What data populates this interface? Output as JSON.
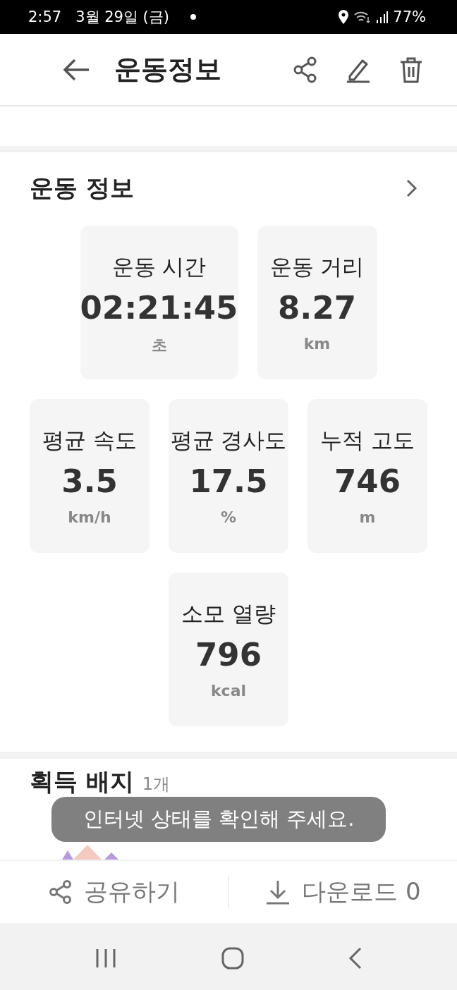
{
  "status_bar": {
    "time": "2:57",
    "date": "3월 29일 (금)",
    "battery": "77%"
  },
  "app_bar": {
    "title": "운동정보"
  },
  "workout_info": {
    "title": "운동 정보",
    "stats": [
      {
        "label": "운동 시간",
        "value": "02:21:45",
        "unit": "초"
      },
      {
        "label": "운동 거리",
        "value": "8.27",
        "unit": "km"
      },
      {
        "label": "평균 속도",
        "value": "3.5",
        "unit": "km/h"
      },
      {
        "label": "평균 경사도",
        "value": "17.5",
        "unit": "%"
      },
      {
        "label": "누적 고도",
        "value": "746",
        "unit": "m"
      },
      {
        "label": "소모 열량",
        "value": "796",
        "unit": "kcal"
      }
    ]
  },
  "badges": {
    "title": "획득 배지",
    "count": "1개"
  },
  "toast": {
    "text": "인터넷 상태를 확인해 주세요."
  },
  "bottom_bar": {
    "buttons": [
      {
        "kind": "share",
        "label": "공유하기"
      },
      {
        "kind": "download",
        "label": "다운로드 0"
      }
    ]
  }
}
